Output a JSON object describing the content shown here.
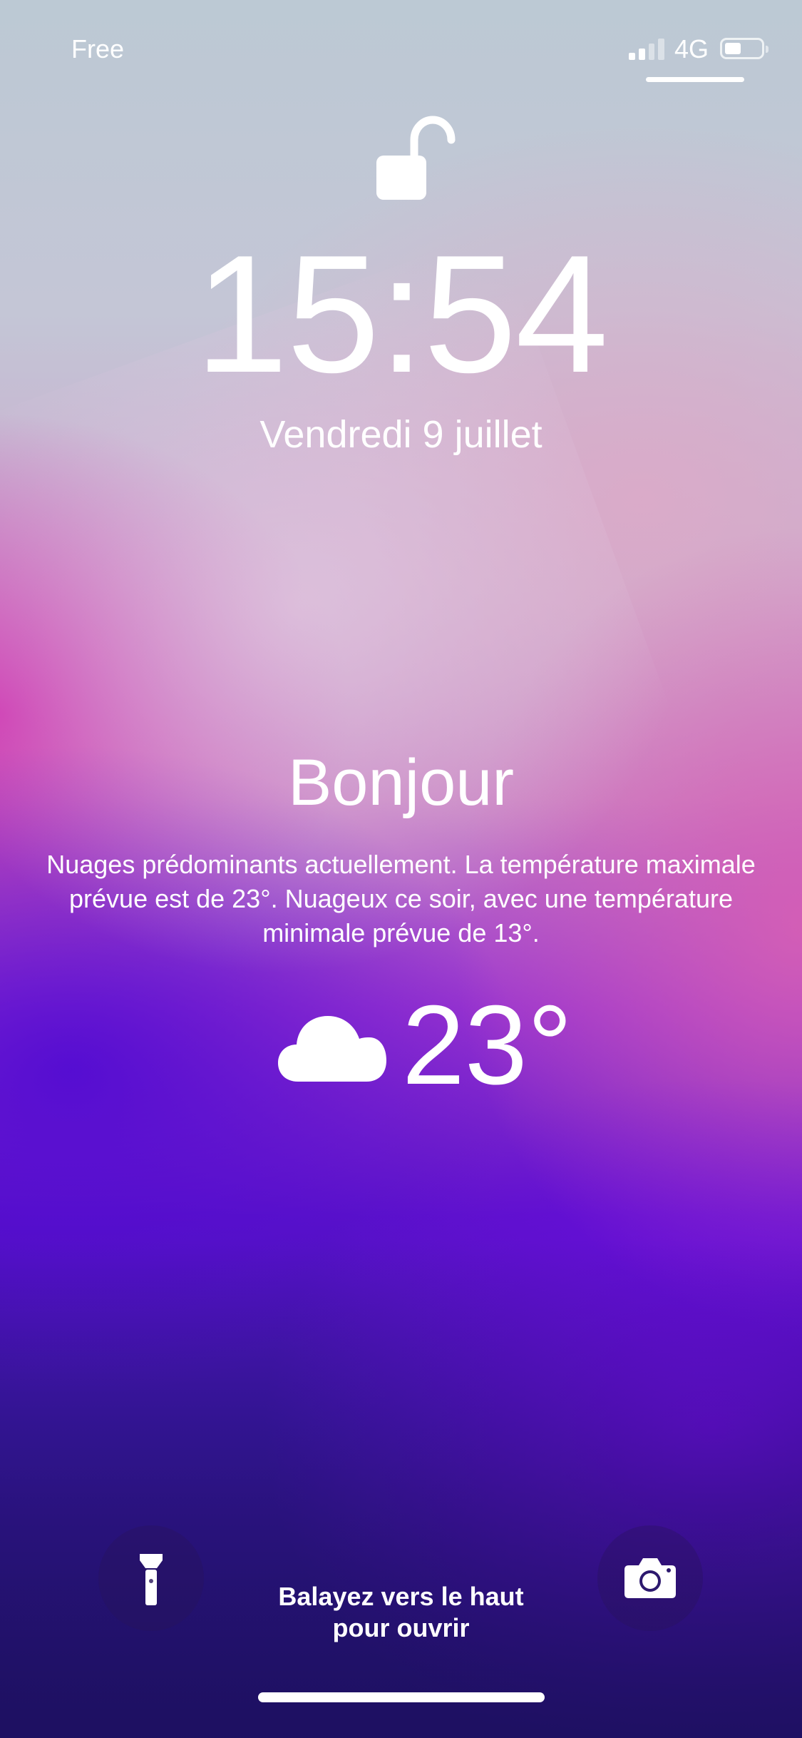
{
  "status_bar": {
    "carrier": "Free",
    "network": "4G",
    "signal_bars_active": 2,
    "signal_bars_total": 4,
    "battery_level": 0.35
  },
  "lock": {
    "icon": "unlocked-padlock-icon"
  },
  "clock": {
    "time": "15:54",
    "date": "Vendredi 9 juillet"
  },
  "weather": {
    "greeting": "Bonjour",
    "summary": "Nuages prédominants actuellement. La température maximale prévue est de 23°. Nuageux ce soir, avec une température minimale prévue de 13°.",
    "icon": "cloud-icon",
    "temperature": "23°"
  },
  "controls": {
    "flashlight_icon": "flashlight-icon",
    "camera_icon": "camera-icon",
    "swipe_line1": "Balayez vers le haut",
    "swipe_line2": "pour ouvrir"
  },
  "colors": {
    "text": "#ffffff",
    "wallpaper_top": "#bcc9d4",
    "wallpaper_pink": "#cd2daf",
    "wallpaper_purple": "#5a12c9",
    "wallpaper_bottom": "#25136e"
  }
}
